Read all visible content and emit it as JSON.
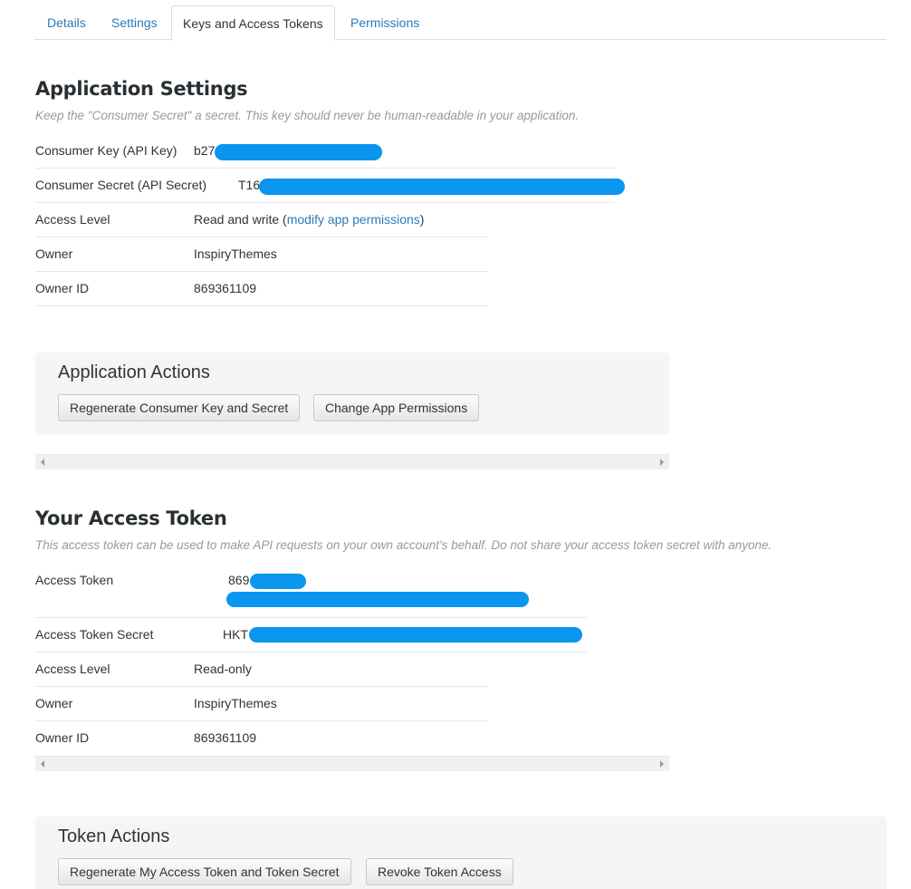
{
  "tabs": [
    {
      "label": "Details"
    },
    {
      "label": "Settings"
    },
    {
      "label": "Keys and Access Tokens"
    },
    {
      "label": "Permissions"
    }
  ],
  "app_settings": {
    "title": "Application Settings",
    "description": "Keep the \"Consumer Secret\" a secret. This key should never be human-readable in your application.",
    "rows": [
      {
        "label": "Consumer Key (API Key)",
        "value": "b27"
      },
      {
        "label": "Consumer Secret (API Secret)",
        "value": "T16"
      },
      {
        "label": "Access Level",
        "value_prefix": "Read and write (",
        "link": "modify app permissions",
        "value_suffix": ")"
      },
      {
        "label": "Owner",
        "value": "InspiryThemes"
      },
      {
        "label": "Owner ID",
        "value": "869361109"
      }
    ]
  },
  "app_actions": {
    "title": "Application Actions",
    "buttons": [
      "Regenerate Consumer Key and Secret",
      "Change App Permissions"
    ]
  },
  "access_token": {
    "title": "Your Access Token",
    "description": "This access token can be used to make API requests on your own account's behalf. Do not share your access token secret with anyone.",
    "rows": [
      {
        "label": "Access Token",
        "value": "869"
      },
      {
        "label": "Access Token Secret",
        "value": "HKT"
      },
      {
        "label": "Access Level",
        "value": "Read-only"
      },
      {
        "label": "Owner",
        "value": "InspiryThemes"
      },
      {
        "label": "Owner ID",
        "value": "869361109"
      }
    ]
  },
  "token_actions": {
    "title": "Token Actions",
    "buttons": [
      "Regenerate My Access Token and Token Secret",
      "Revoke Token Access"
    ]
  },
  "colors": {
    "link": "#2b7bb9",
    "redaction": "#0a95ef"
  }
}
